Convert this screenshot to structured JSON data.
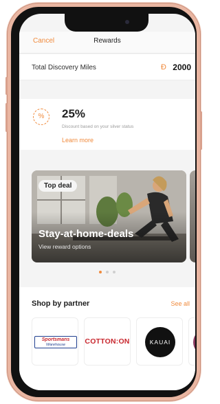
{
  "nav": {
    "cancel": "Cancel",
    "title": "Rewards"
  },
  "miles": {
    "label": "Total Discovery Miles",
    "icon": "discovery-miles-icon",
    "value": "2000"
  },
  "discount": {
    "badge_icon": "percent-badge-icon",
    "badge_symbol": "%",
    "percent": "25%",
    "description": "Discount based on your silver status",
    "link": "Learn more"
  },
  "deal": {
    "badge": "Top deal",
    "title": "Stay-at-home-deals",
    "subtitle": "View reward options"
  },
  "carousel": {
    "pages": 3,
    "active_page": 1
  },
  "shop": {
    "title": "Shop by partner",
    "see_all": "See all",
    "partners": [
      {
        "line1": "Sportsmans",
        "line2": "Warehouse"
      },
      {
        "name": "COTTON:ON"
      },
      {
        "name": "KAUAI"
      }
    ]
  },
  "colors": {
    "accent": "#f08a3c",
    "frame": "#e9b6a2",
    "bezel": "#111111"
  }
}
